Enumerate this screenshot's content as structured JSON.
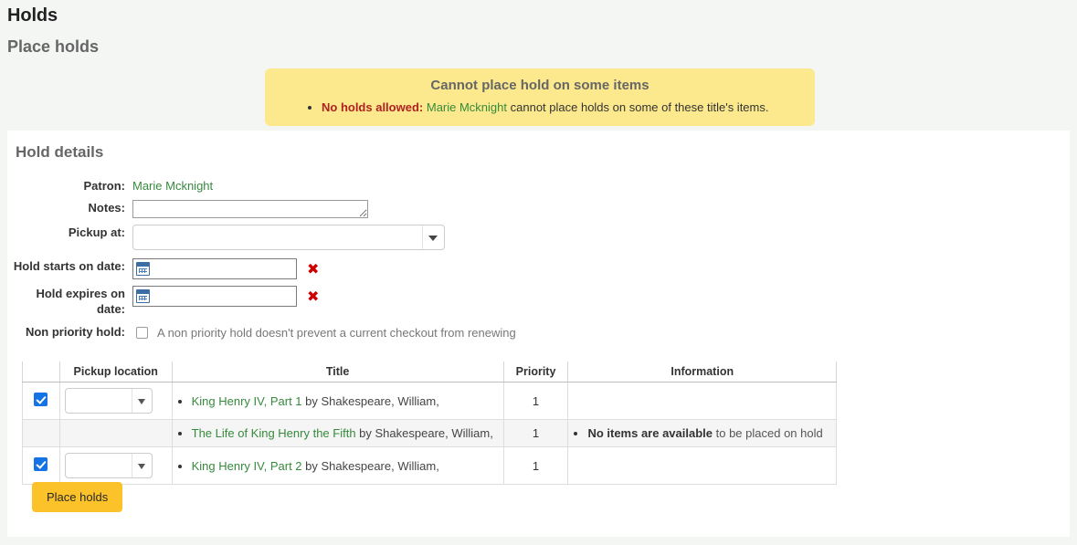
{
  "page": {
    "title": "Holds",
    "section_title": "Place holds"
  },
  "alert": {
    "title": "Cannot place hold on some items",
    "items": [
      {
        "strong": "No holds allowed:",
        "patron": "Marie Mcknight",
        "rest": "cannot place holds on some of these title's items."
      }
    ]
  },
  "panel": {
    "title": "Hold details"
  },
  "form": {
    "patron_label": "Patron:",
    "patron_name": "Marie Mcknight",
    "notes_label": "Notes:",
    "notes_value": "",
    "notes_placeholder": "",
    "pickup_label": "Pickup at:",
    "pickup_value": "",
    "hold_starts_label": "Hold starts on date:",
    "hold_starts_value": "",
    "hold_expires_label": "Hold expires on date:",
    "hold_expires_value": "",
    "non_priority_label": "Non priority hold:",
    "non_priority_hint": "A non priority hold doesn't prevent a current checkout from renewing",
    "non_priority_checked": false,
    "clear_icon": "✖"
  },
  "table": {
    "headers": [
      "",
      "Pickup location",
      "Title",
      "Priority",
      "Information"
    ],
    "rows": [
      {
        "checked": true,
        "has_pickup_select": true,
        "pickup_value": "",
        "title": "King Henry IV, Part 1",
        "author": "by Shakespeare, William,",
        "priority": "1",
        "info_strong": "",
        "info_rest": "",
        "alt": false
      },
      {
        "checked": false,
        "has_pickup_select": false,
        "pickup_value": "",
        "title": "The Life of King Henry the Fifth",
        "author": "by Shakespeare, William,",
        "priority": "1",
        "info_strong": "No items are available",
        "info_rest": "to be placed on hold",
        "alt": true
      },
      {
        "checked": true,
        "has_pickup_select": true,
        "pickup_value": "",
        "title": "King Henry IV, Part 2",
        "author": "by Shakespeare, William,",
        "priority": "1",
        "info_strong": "",
        "info_rest": "",
        "alt": false
      }
    ]
  },
  "actions": {
    "place_holds_label": "Place holds"
  },
  "colors": {
    "alert_bg": "#fce98d",
    "alert_strong": "#b02121",
    "link_green": "#368a3d",
    "button_yellow": "#fbc22a",
    "checkbox_blue": "#1573e6",
    "clear_red": "#cc0000"
  }
}
